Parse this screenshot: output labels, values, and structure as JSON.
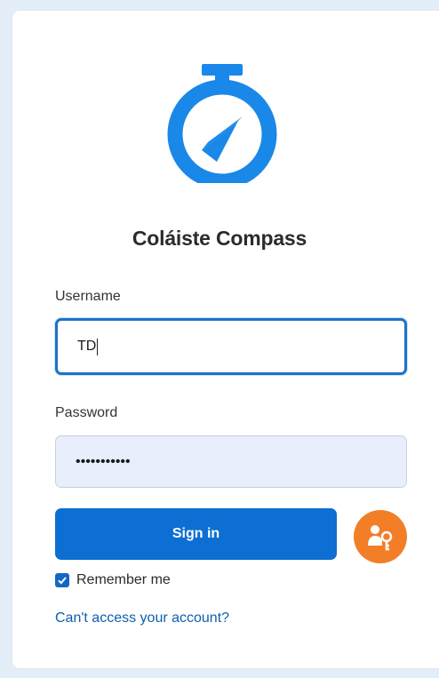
{
  "app": {
    "title": "Coláiste Compass"
  },
  "form": {
    "username_label": "Username",
    "username_value": "TD",
    "password_label": "Password",
    "password_value": "•••••••••••",
    "signin_label": "Sign in",
    "remember_label": "Remember me",
    "remember_checked": true,
    "help_link": "Can't access your account?"
  },
  "icons": {
    "logo": "compass-stopwatch-icon",
    "passkey": "passkey-icon",
    "checkbox": "checkmark-icon"
  },
  "colors": {
    "brand_blue": "#1a88e8",
    "button_blue": "#0d6ed3",
    "passkey_orange": "#f27f28",
    "link_blue": "#0f5fae",
    "focus_border": "#1e72c8"
  }
}
